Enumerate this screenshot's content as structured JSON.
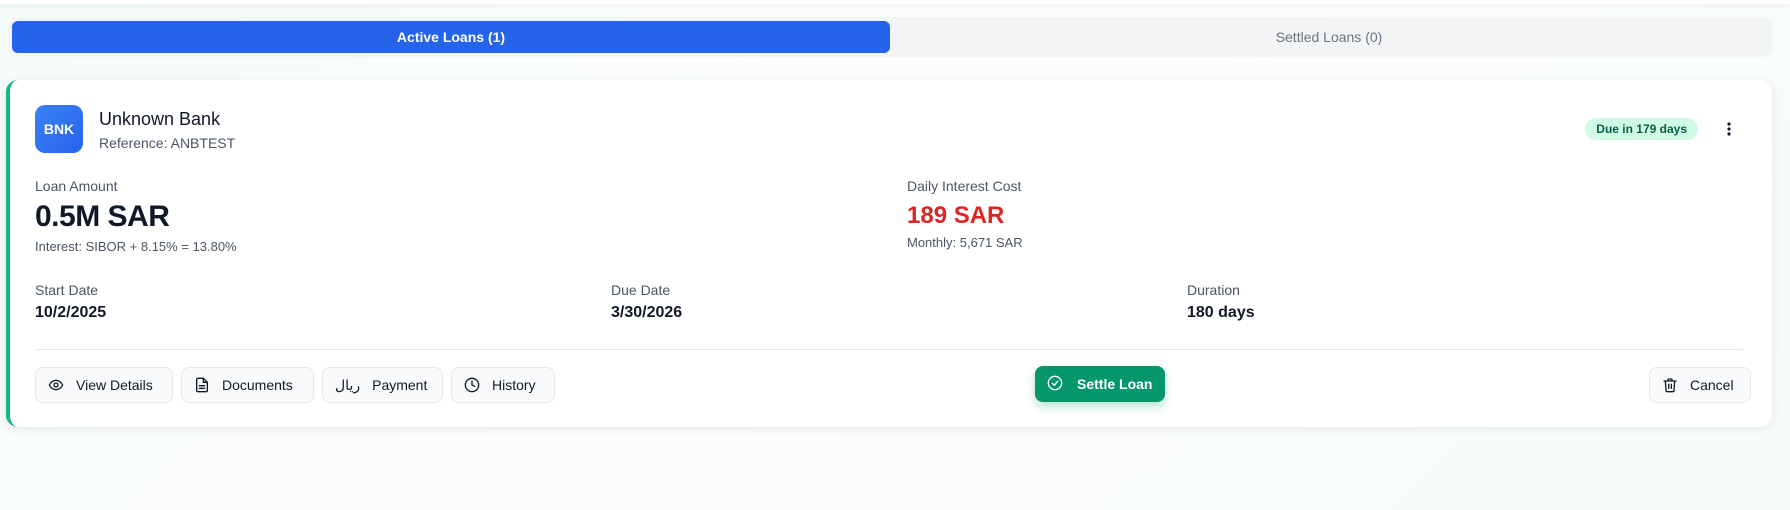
{
  "tabs": {
    "active_label": "Active Loans (1)",
    "settled_label": "Settled Loans (0)"
  },
  "loan": {
    "avatar_text": "BNK",
    "bank_name": "Unknown Bank",
    "reference": "Reference: ANBTEST",
    "due_badge": "Due in 179 days",
    "loan_amount_label": "Loan Amount",
    "loan_amount": "0.5M SAR",
    "interest": "Interest: SIBOR + 8.15% = 13.80%",
    "daily_cost_label": "Daily Interest Cost",
    "daily_cost": "189 SAR",
    "monthly": "Monthly: 5,671 SAR",
    "start_label": "Start Date",
    "start_date": "10/2/2025",
    "due_label": "Due Date",
    "due_date": "3/30/2026",
    "duration_label": "Duration",
    "duration": "180 days"
  },
  "actions": {
    "view_details": "View Details",
    "documents": "Documents",
    "payment_icon_text": "ريال",
    "payment": "Payment",
    "history": "History",
    "settle": "Settle Loan",
    "cancel": "Cancel"
  },
  "colors": {
    "primary": "#2563eb",
    "success": "#059669",
    "accent_border": "#10b981",
    "danger": "#dc2626",
    "badge_bg": "#d1fae5"
  },
  "icons": [
    "eye-icon",
    "document-icon",
    "rial-icon",
    "clock-icon",
    "check-circle-icon",
    "trash-icon",
    "more-vertical-icon"
  ]
}
